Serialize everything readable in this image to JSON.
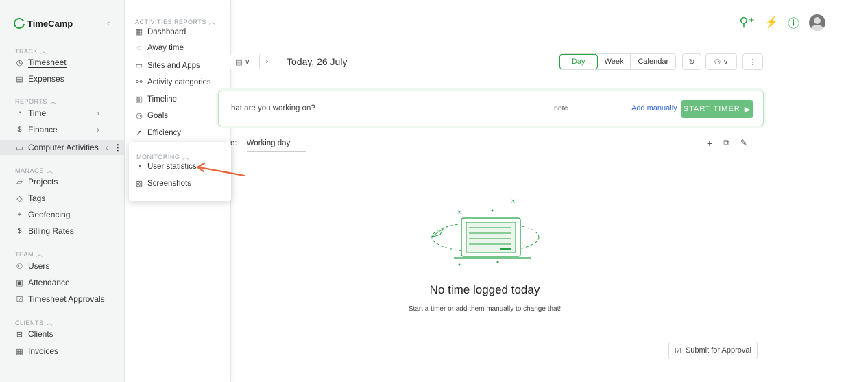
{
  "brand": {
    "name": "TimeCamp",
    "accent": "#25a244"
  },
  "sidebar": {
    "collapse_icon": "‹",
    "sections": [
      {
        "label": "TRACK",
        "items": [
          {
            "label": "Timesheet",
            "icon": "clock-icon"
          },
          {
            "label": "Expenses",
            "icon": "receipt-icon"
          }
        ]
      },
      {
        "label": "REPORTS",
        "items": [
          {
            "label": "Time",
            "icon": "pie-icon"
          },
          {
            "label": "Finance",
            "icon": "dollar-icon"
          },
          {
            "label": "Computer Activities",
            "icon": "laptop-icon"
          }
        ]
      },
      {
        "label": "MANAGE",
        "items": [
          {
            "label": "Projects",
            "icon": "folder-icon"
          },
          {
            "label": "Tags",
            "icon": "tag-icon"
          },
          {
            "label": "Geofencing",
            "icon": "map-icon"
          },
          {
            "label": "Billing Rates",
            "icon": "dollar-icon"
          }
        ]
      },
      {
        "label": "TEAM",
        "items": [
          {
            "label": "Users",
            "icon": "users-icon"
          },
          {
            "label": "Attendance",
            "icon": "calendar-icon"
          },
          {
            "label": "Timesheet Approvals",
            "icon": "approval-icon"
          }
        ]
      },
      {
        "label": "CLIENTS",
        "items": [
          {
            "label": "Clients",
            "icon": "briefcase-icon"
          },
          {
            "label": "Invoices",
            "icon": "invoice-icon"
          }
        ]
      }
    ]
  },
  "activities_menu": {
    "section": "ACTIVITIES REPORTS",
    "items": [
      "Dashboard",
      "Away time",
      "Sites and Apps",
      "Activity categories",
      "Timeline",
      "Goals",
      "Efficiency"
    ]
  },
  "monitoring": {
    "section": "MONITORING",
    "items": [
      "User statistics",
      "Screenshots"
    ]
  },
  "toolbar": {
    "date": "Today, 26 July",
    "views": [
      "Day",
      "Week",
      "Calendar"
    ]
  },
  "timer": {
    "placeholder": "hat are you working on?",
    "note": "note",
    "add_manually": "Add manually",
    "start": "START TIMER"
  },
  "day_type": {
    "label": "e:",
    "value": "Working day"
  },
  "empty": {
    "title": "No time logged today",
    "subtitle": "Start a timer or add them manually to change that!"
  },
  "submit": "Submit for Approval",
  "arrow_color": "#e8643b"
}
